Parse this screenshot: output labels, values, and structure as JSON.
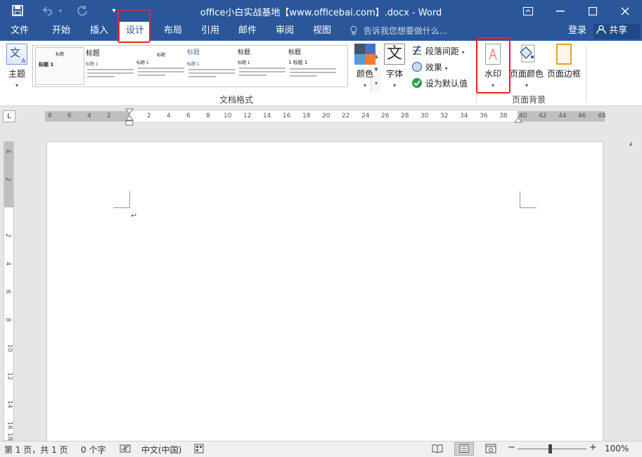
{
  "window": {
    "title": "office小白实战基地【www.officebai.com】.docx - Word",
    "controls": [
      "ribbon-display",
      "minimize",
      "maximize",
      "close"
    ]
  },
  "quick_access": {
    "save_icon": "save-icon",
    "undo_icon": "undo-icon",
    "redo_icon": "redo-icon",
    "customize_icon": "customize-qat-icon"
  },
  "tabs": [
    {
      "label": "文件"
    },
    {
      "label": "开始"
    },
    {
      "label": "插入"
    },
    {
      "label": "设计",
      "active": true
    },
    {
      "label": "布局"
    },
    {
      "label": "引用"
    },
    {
      "label": "邮件"
    },
    {
      "label": "审阅"
    },
    {
      "label": "视图"
    }
  ],
  "tell_me": {
    "placeholder": "告诉我您想要做什么..."
  },
  "account": {
    "signin": "登录",
    "share": "共享"
  },
  "ribbon": {
    "theme": {
      "label": "主题",
      "icon_glyph": "文"
    },
    "gallery": {
      "items": [
        {
          "title": "标题",
          "heading": "标题 1"
        },
        {
          "title": "标题",
          "heading": "标题 1"
        },
        {
          "title": "标题",
          "heading": "标题 1"
        },
        {
          "title": "标题",
          "heading": "标题 1"
        },
        {
          "title": "标题",
          "heading": "标题 1"
        },
        {
          "title": "标题",
          "heading": "1 标题 1"
        }
      ],
      "group_label": "文档格式"
    },
    "colors": {
      "label": "颜色"
    },
    "fonts": {
      "label": "字体",
      "glyph": "文"
    },
    "paragraph_spacing": {
      "label": "段落间距"
    },
    "effects": {
      "label": "效果"
    },
    "set_default": {
      "label": "设为默认值"
    },
    "watermark": {
      "label": "水印"
    },
    "page_color": {
      "label": "页面颜色"
    },
    "page_borders": {
      "label": "页面边框"
    },
    "page_background_group": "页面背景"
  },
  "ruler": {
    "h_left": [
      "8",
      "6",
      "4",
      "2"
    ],
    "h_right": [
      "2",
      "4",
      "6",
      "8",
      "10",
      "12",
      "14",
      "16",
      "18",
      "20",
      "22",
      "24",
      "26",
      "28",
      "30",
      "32",
      "34",
      "36",
      "38",
      "40",
      "42",
      "44",
      "46",
      "48"
    ],
    "v_top": [
      "4",
      "2"
    ],
    "v_main": [
      "2",
      "4",
      "6",
      "8",
      "10",
      "12",
      "14",
      "16",
      "18"
    ]
  },
  "document": {
    "paragraph_mark": "↵"
  },
  "status": {
    "page": "第 1 页，共 1 页",
    "words": "0 个字",
    "language": "中文(中国)",
    "zoom": "100%",
    "zoom_out": "−",
    "zoom_in": "+",
    "zoom_level": 1.0
  },
  "colors": {
    "accent": "#2b579a",
    "highlight": "#e22222"
  }
}
